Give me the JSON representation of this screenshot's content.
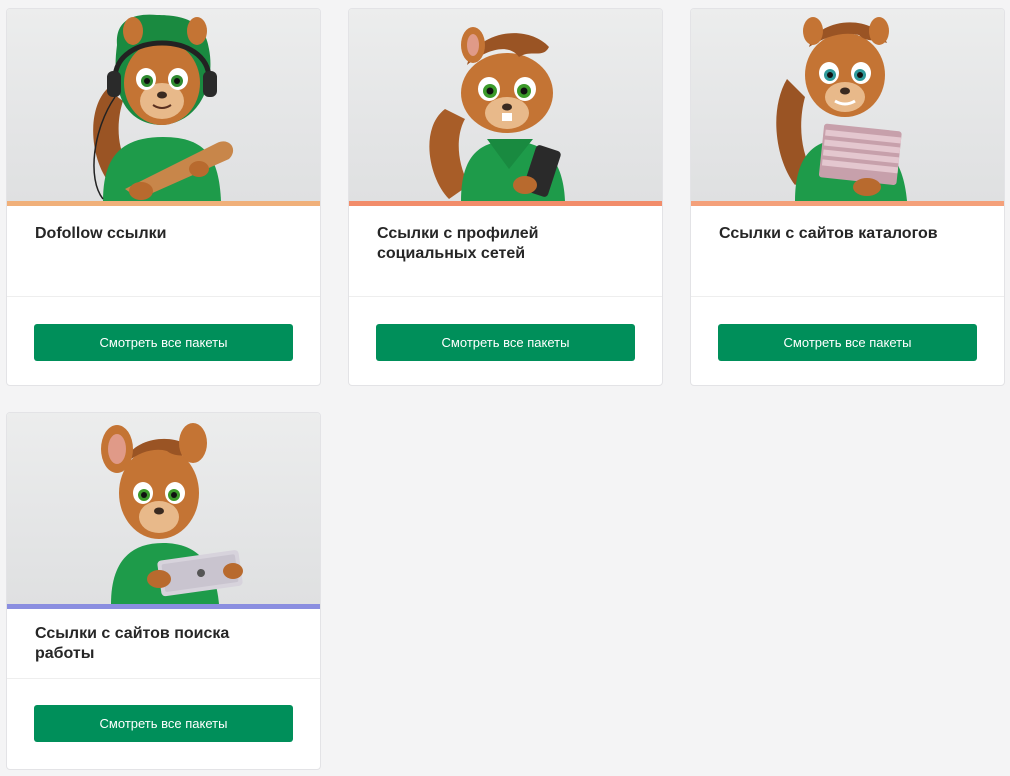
{
  "theme": {
    "button_color": "#008f5a",
    "hoodie_color": "#1e9b4a",
    "fur_color": "#b86a2e"
  },
  "cards": [
    {
      "title": "Dofollow ссылки",
      "button_label": "Смотреть все пакеты",
      "accent_color": "#f0b07a",
      "image_icon": "squirrel-headphones-bat-icon"
    },
    {
      "title": "Ссылки с профилей социальных сетей",
      "button_label": "Смотреть все пакеты",
      "accent_color": "#f28c6a",
      "image_icon": "squirrel-phone-icon"
    },
    {
      "title": "Ссылки с сайтов каталогов",
      "button_label": "Смотреть все пакеты",
      "accent_color": "#f4a07a",
      "image_icon": "squirrel-cards-icon"
    },
    {
      "title": "Ссылки с сайтов поиска работы",
      "button_label": "Смотреть все пакеты",
      "accent_color": "#8a8ee0",
      "image_icon": "squirrel-tablet-icon"
    }
  ]
}
